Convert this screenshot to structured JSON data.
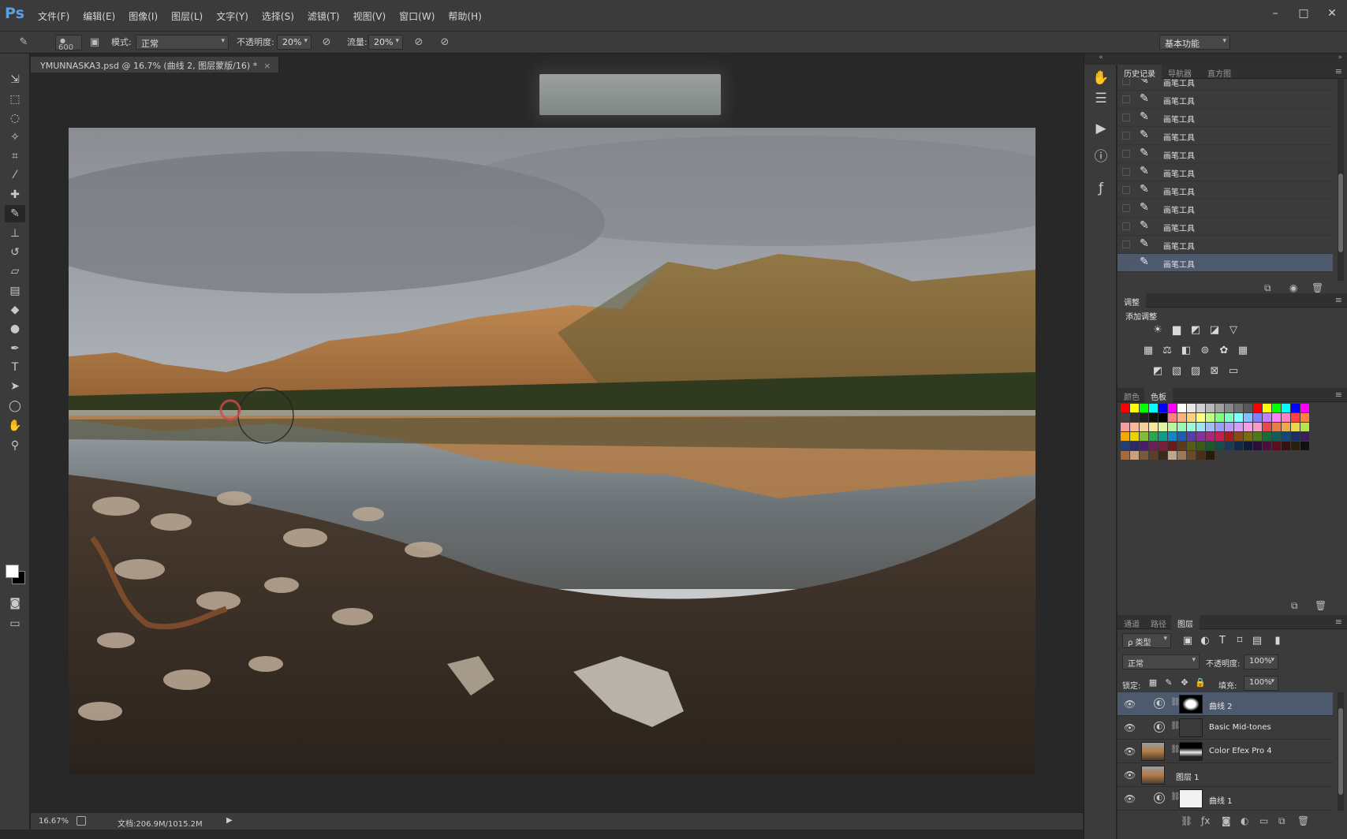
{
  "app": {
    "logo": "Ps"
  },
  "menu": [
    "文件(F)",
    "编辑(E)",
    "图像(I)",
    "图层(L)",
    "文字(Y)",
    "选择(S)",
    "滤镜(T)",
    "视图(V)",
    "窗口(W)",
    "帮助(H)"
  ],
  "window_controls": {
    "minimize": "–",
    "maximize": "□",
    "close": "✕"
  },
  "options": {
    "brush_size": "600",
    "mode_label": "模式:",
    "mode_value": "正常",
    "opacity_label": "不透明度:",
    "opacity_value": "20%",
    "flow_label": "流量:",
    "flow_value": "20%",
    "workspace": "基本功能"
  },
  "document": {
    "tab_title": "YMUNNASKA3.psd @ 16.7% (曲线 2, 图层蒙版/16) *",
    "tab_close": "×",
    "zoom": "16.67%",
    "doc_info": "文档:206.9M/1015.2M",
    "status_arrow": "▶"
  },
  "history_panel": {
    "tabs": [
      "历史记录",
      "导航器",
      "直方图"
    ],
    "rows": [
      "画笔工具",
      "画笔工具",
      "画笔工具",
      "画笔工具",
      "画笔工具",
      "画笔工具",
      "画笔工具",
      "画笔工具",
      "画笔工具",
      "画笔工具",
      "画笔工具"
    ],
    "selected_index": 10
  },
  "adjustments_panel": {
    "tab": "调整",
    "title": "添加调整"
  },
  "swatches_panel": {
    "tabs": [
      "颜色",
      "色板"
    ],
    "rows": [
      [
        "#ff0000",
        "#ffff00",
        "#00ff00",
        "#00ffff",
        "#0000ff",
        "#ff00ff",
        "#ffffff",
        "#e8e8e8",
        "#d0d0d0",
        "#b8b8b8",
        "#a0a0a0",
        "#888888",
        "#707070",
        "#585858",
        "#ff0000",
        "#ffff00",
        "#00ff00",
        "#00ffff",
        "#0000ff",
        "#ff00ff"
      ],
      [
        "#404040",
        "#303030",
        "#202020",
        "#101010",
        "#000000",
        "#ff8080",
        "#ffb080",
        "#ffd080",
        "#ffff80",
        "#c0ff80",
        "#80ff80",
        "#80ffc0",
        "#80ffff",
        "#80c0ff",
        "#8080ff",
        "#c080ff",
        "#ff80ff",
        "#ff80c0",
        "#ff4040",
        "#ff8040"
      ],
      [
        "#f79d9d",
        "#f7b79d",
        "#f7cf9d",
        "#f7e79d",
        "#e2f79d",
        "#b8f79d",
        "#9df7b0",
        "#9df7d9",
        "#9de4f7",
        "#9dc1f7",
        "#9d9ff7",
        "#b69df7",
        "#d89df7",
        "#f79de8",
        "#f79dc4",
        "#e64a4a",
        "#e67e4a",
        "#e6ab4a",
        "#e6d84a",
        "#b6e64a"
      ],
      [
        "#f2a900",
        "#e8d200",
        "#7fbe34",
        "#2da44e",
        "#0f9d8b",
        "#1288c9",
        "#1f5db5",
        "#5a3ea6",
        "#8a2f9e",
        "#b0247a",
        "#c81e4f",
        "#a81c1c",
        "#8a4a12",
        "#7a6a10",
        "#4c7a1a",
        "#1a6b3a",
        "#0c5f5a",
        "#0c4a7a",
        "#1c2f6b",
        "#3a1f5c"
      ],
      [
        "#1f3f7a",
        "#2a2a6a",
        "#4a1f6a",
        "#6a1f5a",
        "#7a1f3a",
        "#6a1a1a",
        "#5a3a1a",
        "#5a5a1a",
        "#3a5a1a",
        "#1a5a2a",
        "#1a4a4a",
        "#1a3a5a",
        "#0f2a4a",
        "#101a3a",
        "#2a0f3a",
        "#4a0f3a",
        "#5a0f20",
        "#3a0f0f",
        "#2a2010",
        "#101010"
      ],
      [
        "#a86a3a",
        "#c9a07a",
        "#7a5a3a",
        "#5a4028",
        "#3a2a1a",
        "#bfa68a",
        "#9a7a5a",
        "#6a4a2a",
        "#4a3018",
        "#2a1a0a"
      ]
    ]
  },
  "layers_panel": {
    "tabs": [
      "通道",
      "路径",
      "图层"
    ],
    "filter_label": "ρ 类型",
    "blend_mode": "正常",
    "opacity_label": "不透明度:",
    "opacity_value": "100%",
    "lock_label": "锁定:",
    "fill_label": "填充:",
    "fill_value": "100%",
    "layers": [
      {
        "name": "曲线 2",
        "selected": true
      },
      {
        "name": "Basic Mid-tones",
        "selected": false
      },
      {
        "name": "Color Efex Pro 4",
        "selected": false
      },
      {
        "name": "图层 1",
        "selected": false
      },
      {
        "name": "曲线 1",
        "selected": false
      }
    ]
  }
}
